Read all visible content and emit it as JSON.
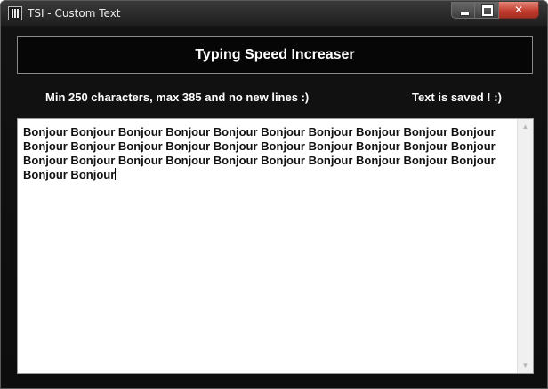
{
  "window": {
    "title": "TSI - Custom Text"
  },
  "header": {
    "title": "Typing Speed Increaser"
  },
  "status": {
    "hint": "Min 250 characters, max 385 and no new lines :)",
    "saved": "Text is saved ! :)"
  },
  "editor": {
    "text": "Bonjour Bonjour Bonjour Bonjour Bonjour Bonjour Bonjour Bonjour Bonjour Bonjour Bonjour Bonjour Bonjour Bonjour Bonjour Bonjour Bonjour Bonjour Bonjour Bonjour Bonjour Bonjour Bonjour Bonjour Bonjour Bonjour Bonjour Bonjour Bonjour Bonjour Bonjour Bonjour"
  },
  "icons": {
    "app": "app-icon",
    "minimize": "minimize-icon",
    "maximize": "maximize-icon",
    "close": "close-icon",
    "scroll_up": "scroll-up-arrow-icon",
    "scroll_down": "scroll-down-arrow-icon"
  },
  "colors": {
    "background": "#0d0d0d",
    "text": "#ffffff",
    "close_button": "#c0392b"
  }
}
